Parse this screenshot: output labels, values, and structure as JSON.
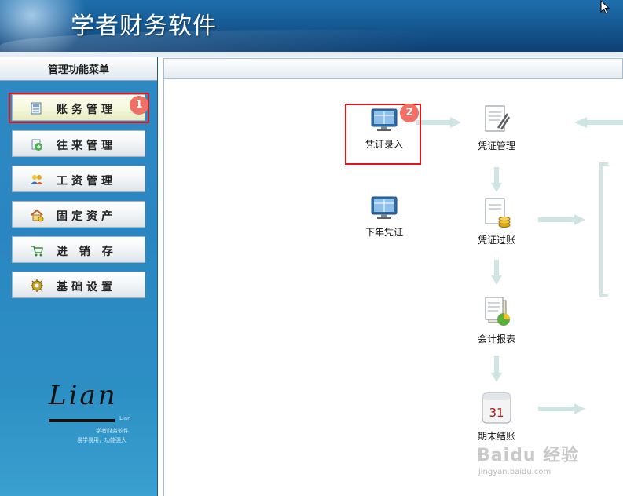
{
  "header": {
    "title": "学者财务软件"
  },
  "sidebar": {
    "title": "管理功能菜单",
    "items": [
      {
        "label": "账务管理"
      },
      {
        "label": "往来管理"
      },
      {
        "label": "工资管理"
      },
      {
        "label": "固定资产"
      },
      {
        "label": "进 销 存"
      },
      {
        "label": "基础设置"
      }
    ],
    "logo": {
      "text": "Lian",
      "small": "Lian",
      "line1": "学者财务软件",
      "line2": "易学易用，功能强大"
    }
  },
  "annotations": {
    "badge1": "1",
    "badge2": "2"
  },
  "flow": {
    "voucher_entry": "凭证录入",
    "voucher_manage": "凭证管理",
    "next_year_voucher": "下年凭证",
    "voucher_posting": "凭证过账",
    "accounting_reports": "会计报表",
    "period_close": "期末结账",
    "calendar_day": "31"
  },
  "watermark": {
    "logo": "Baidu 经验",
    "url": "jingyan.baidu.com"
  },
  "colors": {
    "highlight": "#e0151b",
    "badge": "#f07065",
    "arrow": "#cfe5e3"
  }
}
